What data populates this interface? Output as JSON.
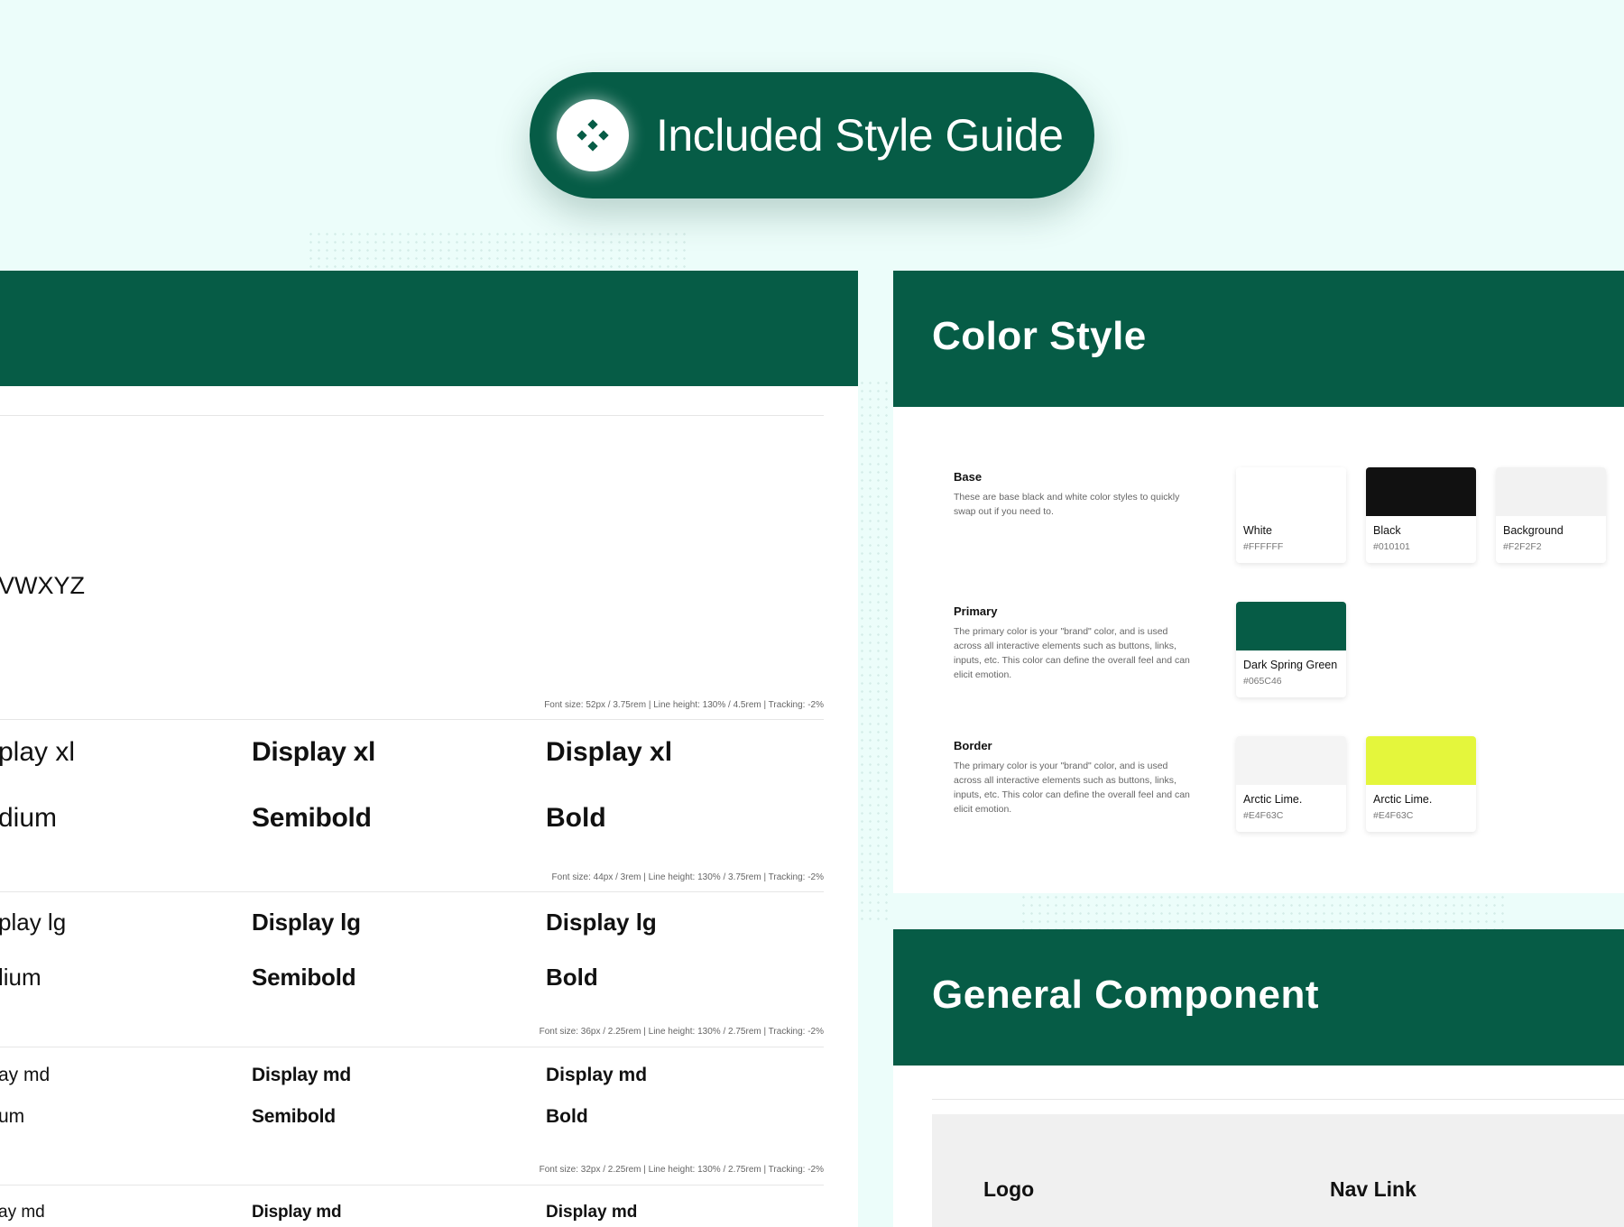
{
  "banner": {
    "title": "Included Style Guide",
    "icon": "diamond-grid-icon",
    "background": "#065C46"
  },
  "typography": {
    "alphabet_fragment": "VWXYZ",
    "rows": [
      {
        "spec": "Font size: 52px / 3.75rem | Line height: 130% / 4.5rem | Tracking: -2%",
        "medium_name": "play xl",
        "medium_weight": "dium",
        "semibold_name": "Display xl",
        "semibold_weight": "Semibold",
        "bold_name": "Display xl",
        "bold_weight": "Bold"
      },
      {
        "spec": "Font size: 44px / 3rem | Line height: 130% / 3.75rem | Tracking: -2%",
        "medium_name": "play lg",
        "medium_weight": "lium",
        "semibold_name": "Display lg",
        "semibold_weight": "Semibold",
        "bold_name": "Display lg",
        "bold_weight": "Bold"
      },
      {
        "spec": "Font size: 36px / 2.25rem | Line height: 130% / 2.75rem | Tracking: -2%",
        "medium_name": "ay md",
        "medium_weight": "um",
        "semibold_name": "Display md",
        "semibold_weight": "Semibold",
        "bold_name": "Display md",
        "bold_weight": "Bold"
      },
      {
        "spec": "Font size: 32px / 2.25rem | Line height: 130% / 2.75rem | Tracking: -2%",
        "medium_name": "ay md",
        "semibold_name": "Display md",
        "bold_name": "Display md"
      }
    ]
  },
  "color_style": {
    "title": "Color Style",
    "groups": [
      {
        "name": "Base",
        "description": "These are base black and white color styles to quickly swap out if you need to.",
        "swatches": [
          {
            "name": "White",
            "hex": "#FFFFFF",
            "color": "#FFFFFF"
          },
          {
            "name": "Black",
            "hex": "#010101",
            "color": "#111111"
          },
          {
            "name": "Background",
            "hex": "#F2F2F2",
            "color": "#F2F2F2"
          }
        ]
      },
      {
        "name": "Primary",
        "description": "The primary color is your \"brand\" color, and is used across all interactive elements such as buttons, links, inputs, etc. This color can define the overall feel and can elicit emotion.",
        "swatches": [
          {
            "name": "Dark Spring Green",
            "hex": "#065C46",
            "color": "#065C46"
          }
        ]
      },
      {
        "name": "Border",
        "description": "The primary color is your \"brand\" color, and is used across all interactive elements such as buttons, links, inputs, etc. This color can define the overall feel and can elicit emotion.",
        "swatches": [
          {
            "name": "Arctic Lime.",
            "hex": "#E4F63C",
            "color": "#F4F4F4"
          },
          {
            "name": "Arctic Lime.",
            "hex": "#E4F63C",
            "color": "#E4F63C"
          }
        ]
      }
    ]
  },
  "general_component": {
    "title": "General Component",
    "logo_label": "Logo",
    "nav_link_label": "Nav Link"
  },
  "colors": {
    "brand": "#065C46",
    "page_background": "#ECFDFA",
    "accent": "#E4F63C"
  }
}
